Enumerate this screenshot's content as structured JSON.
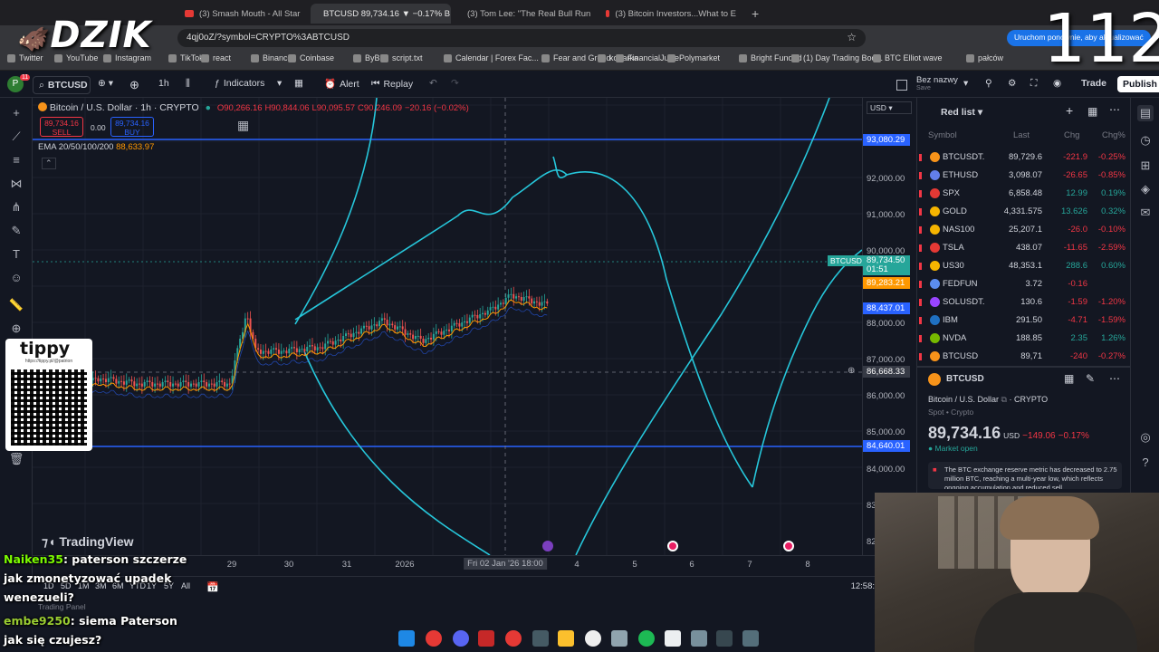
{
  "browser": {
    "tabs": [
      {
        "label": "(3) Smash Mouth - All Star",
        "icon": "youtube-icon"
      },
      {
        "label": "BTCUSD 89,734.16 ▼ −0.17% B",
        "icon": "tradingview-icon",
        "active": true
      },
      {
        "label": "(3) Tom Lee: \"The Real Bull Run",
        "icon": "youtube-icon"
      },
      {
        "label": "(3) Bitcoin Investors...What to E",
        "icon": "youtube-icon"
      }
    ],
    "url": "4qj0oZ/?symbol=CRYPTO%3ABTCUSD",
    "address_right_btn": "Uruchom ponownie, aby",
    "address_right_btn2": "aktualizować",
    "bookmarks": [
      "Twitter",
      "YouTube",
      "Instagram",
      "TikTok",
      "react",
      "Binance",
      "Coinbase",
      "ByBit",
      "script.txt",
      "Calendar | Forex Fac...",
      "Fear and Greed",
      "koparka",
      "FinancialJuice",
      "Polymarket",
      "Bright Funded",
      "(1) Day Trading Boo...",
      "BTC Elliot wave",
      "pałców"
    ]
  },
  "overlay": {
    "logo": "DZIK",
    "counter": "112"
  },
  "toolbar": {
    "symbol": "BTCUSD",
    "interval": "1h",
    "indicators": "Indicators",
    "alert": "Alert",
    "replay": "Replay",
    "layout_name": "Bez nazwy",
    "layout_sub": "Save",
    "trade": "Trade",
    "publish": "Publish",
    "avatar_badge": "11"
  },
  "chart": {
    "title": "Bitcoin / U.S. Dollar · 1h · CRYPTO",
    "ohlc": {
      "o": "O90,266.16",
      "h": "H90,844.06",
      "l": "L90,095.57",
      "c": "C90,246.09",
      "chg": "−20.16 (−0.02%)"
    },
    "sell": {
      "price": "89,734.16",
      "label": "SELL"
    },
    "spread": "0.00",
    "buy": {
      "price": "89,734.16",
      "label": "BUY"
    },
    "ema_label": "EMA 20/50/100/200",
    "ema_value": "88,633.97",
    "currency": "USD",
    "watermark": "TradingView"
  },
  "price_axis": {
    "labels": [
      "92,000.00",
      "91,000.00",
      "90,000.00",
      "88,000.00",
      "87,000.00",
      "86,000.00",
      "85,000.00",
      "84,000.00",
      "83",
      "82"
    ],
    "tag_top": "93,080.29",
    "tag_btc_symbol": "BTCUSD",
    "tag_btc_price": "89,734.50",
    "tag_btc_timer": "01:51",
    "tag_ema": "89,283.21",
    "tag_blue2": "88,437.01",
    "tag_cross": "86,668.33",
    "tag_bottom": "84,640.01"
  },
  "time_axis": {
    "ticks": [
      "29",
      "30",
      "31",
      "2026",
      "Fri 02 Jan '26",
      "18:00",
      "4",
      "5",
      "6",
      "7",
      "8"
    ],
    "clock": "12:58:"
  },
  "bottom": {
    "ranges": [
      "1D",
      "5D",
      "1M",
      "3M",
      "6M",
      "YTD",
      "1Y",
      "5Y",
      "All"
    ],
    "panel": "Trading Panel"
  },
  "watchlist": {
    "title": "Red list",
    "columns": [
      "Symbol",
      "Last",
      "Chg",
      "Chg%"
    ],
    "rows": [
      {
        "symbol": "BTCUSDT.",
        "last": "89,729.6",
        "chg": "-221.9",
        "pct": "-0.25%",
        "up": false,
        "color": "#f7931a"
      },
      {
        "symbol": "ETHUSD",
        "last": "3,098.07",
        "chg": "-26.65",
        "pct": "-0.85%",
        "up": false,
        "color": "#627eea"
      },
      {
        "symbol": "SPX",
        "last": "6,858.48",
        "chg": "12.99",
        "pct": "0.19%",
        "up": true,
        "color": "#e53935"
      },
      {
        "symbol": "GOLD",
        "last": "4,331.575",
        "chg": "13.626",
        "pct": "0.32%",
        "up": true,
        "color": "#f5b400"
      },
      {
        "symbol": "NAS100",
        "last": "25,207.1",
        "chg": "-26.0",
        "pct": "-0.10%",
        "up": false,
        "color": "#f5b400"
      },
      {
        "symbol": "TSLA",
        "last": "438.07",
        "chg": "-11.65",
        "pct": "-2.59%",
        "up": false,
        "color": "#e53935"
      },
      {
        "symbol": "US30",
        "last": "48,353.1",
        "chg": "288.6",
        "pct": "0.60%",
        "up": true,
        "color": "#f5b400"
      },
      {
        "symbol": "FEDFUN",
        "last": "3.72",
        "chg": "-0.16",
        "pct": "",
        "up": false,
        "color": "#5b8def"
      },
      {
        "symbol": "SOLUSDT.",
        "last": "130.6",
        "chg": "-1.59",
        "pct": "-1.20%",
        "up": false,
        "color": "#9945ff"
      },
      {
        "symbol": "IBM",
        "last": "291.50",
        "chg": "-4.71",
        "pct": "-1.59%",
        "up": false,
        "color": "#1f70c1"
      },
      {
        "symbol": "NVDA",
        "last": "188.85",
        "chg": "2.35",
        "pct": "1.26%",
        "up": true,
        "color": "#76b900"
      },
      {
        "symbol": "BTCUSD",
        "last": "89,71",
        "chg": "-240",
        "pct": "-0.27%",
        "up": false,
        "color": "#f7931a"
      }
    ]
  },
  "details": {
    "symbol": "BTCUSD",
    "name": "Bitcoin / U.S. Dollar",
    "exchange": "CRYPTO",
    "type": "Spot • Crypto",
    "price_main": "89,73",
    "price_tail": "4.16",
    "currency": "USD",
    "change": "−149.06",
    "change_pct": "−0.17%",
    "market": "Market open",
    "news": "The BTC exchange reserve metric has decreased to 2.75 million BTC, reaching a multi-year low, which reflects ongoing accumulation and reduced sell..."
  },
  "ad": {
    "brand": "tippy",
    "url": "https://tippy.pl/@patrion"
  },
  "stream_chat": [
    {
      "user": "Naiken35",
      "text": ": paterson szczerze"
    },
    {
      "user": "",
      "text": "jak zmonetyzować upadek"
    },
    {
      "user": "",
      "text": "wenezueli?"
    },
    {
      "user": "embe9250",
      "text": ": siema Paterson"
    },
    {
      "user": "",
      "text": "jak się czujesz?"
    }
  ]
}
